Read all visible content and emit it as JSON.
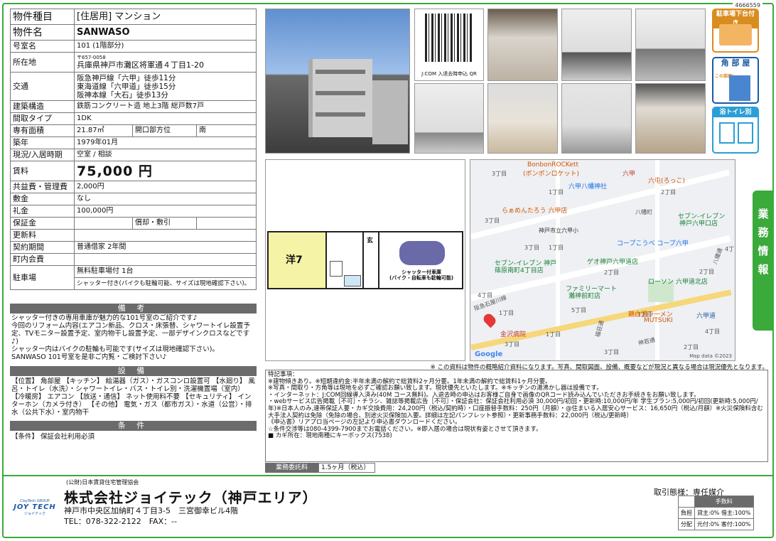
{
  "doc_id": "4666559",
  "table": {
    "type_label": "物件種目",
    "type_value": "[住居用] マンション",
    "name_label": "物件名",
    "name_value": "SANWASO",
    "room_label": "号室名",
    "room_value": "101 (1階部分)",
    "address_label": "所在地",
    "postal": "〒657-0058",
    "address_value": "兵庫県神戸市灘区将軍通４丁目1-20",
    "transport_label": "交通",
    "transport_lines": [
      "阪急神戸線「六甲」徒歩11分",
      "東海道線「六甲道」徒歩15分",
      "阪神本線「大石」徒歩13分"
    ],
    "structure_label": "建築構造",
    "structure_value": "鉄筋コンクリート造 地上3階 総戸数7戸",
    "layout_label": "間取タイプ",
    "layout_value": "1DK",
    "area_label": "専有面積",
    "area_value": "21.87㎡",
    "opening_label": "開口部方位",
    "opening_value": "南",
    "built_label": "築年",
    "built_value": "1979年01月",
    "status_label": "現況/入居時期",
    "status_value": "空室 / 相談",
    "rent_label": "賃料",
    "rent_value": "75,000 円",
    "mgmt_label": "共益費・管理費",
    "mgmt_value": "2,000円",
    "deposit_label": "敷金",
    "deposit_value": "なし",
    "key_label": "礼金",
    "key_value": "100,000円",
    "guarantee_label": "保証金",
    "guarantee_value": "",
    "amort_label": "償却・敷引",
    "amort_value": "",
    "renewal_label": "更新料",
    "renewal_value": "",
    "contract_label": "契約期間",
    "contract_value": "普通借家 2年間",
    "association_label": "町内会費",
    "association_value": "",
    "parking_label": "駐車場",
    "parking_value": "無料駐車場付 1台",
    "parking_note": "シャッター付き(バイクも駐輪可能、サイズは現地確認下さい)。"
  },
  "remarks": {
    "title": "備 考",
    "text": "シャッター付きの専用車庫が魅力的な101号室のご紹介です♪\n今回のリフォーム内容(エアコン新品、クロス・床張替、シャワートイレ設置予定、TVモニター設置予定、室内物干し設置予定、一部デザインクロスなどです♪)\nシャッター内はバイクの駐輪も可能です(サイズは現地確認下さい)。\nSANWASO 101号室を是非ご内覧・ご検討下さい♪"
  },
  "equipment": {
    "title": "設 備",
    "text": "【位置】 角部屋 【キッチン】 給湯器（ガス）・ガスコンロ設置可 【水廻り】 風呂・トイレ（水洗）・シャワートイレ・バス・トイレ別・洗濯機置場（室内） 【冷暖房】 エアコン 【放送・通信】 ネット使用料不要 【セキュリティ】 インターホン（カメラ付き） 【その他】 電気・ガス（都市ガス）・水道（公営）・排水（公共下水）・室内物干"
  },
  "conditions": {
    "title": "条 件",
    "text": "【条件】 保証会社利用必須"
  },
  "qr_label": "J:COM 入退去時申込 QR",
  "badges": {
    "parking": "駐車場下台付き",
    "corner": "角 部 屋",
    "corner_sub": "この部屋!",
    "bath": "浴トイレ別"
  },
  "side_tab": "業務情報",
  "floorplan": {
    "room": "洋7",
    "entrance": "玄",
    "garage": "シャッター付車庫\n(バイク・自転車も駐輪可能)"
  },
  "map": {
    "labels": [
      "3丁目",
      "1丁目",
      "2丁目",
      "3丁目",
      "八幡町",
      "3丁目",
      "1丁目",
      "2丁目",
      "4丁目",
      "5丁目",
      "2丁目",
      "3丁目",
      "4丁目",
      "1丁目",
      "3丁目",
      "1丁目",
      "2丁目",
      "4丁目",
      "3丁目",
      "八幡通",
      "福荘通",
      "神若通",
      "阪急石屋川線",
      "神戸市立六甲小"
    ],
    "poi_orange": [
      "BonbonROCKett",
      "(ボンボンロケット)",
      "六屯(ろっこ)",
      "らぁめんたろう 六甲店",
      "鶏白湯ラーメン",
      "MUTSUKI"
    ],
    "poi_blue": [
      "六甲八幡神社",
      "コープこうべ コープ六甲"
    ],
    "poi_green": [
      "セブン-イレブン",
      "神戸六甲口店",
      "セブン-イレブン 神戸",
      "篠原南町4丁目店",
      "ファミリーマート",
      "灘神前町店",
      "ゲオ神戸六甲道店",
      "ローソン 六甲道北店"
    ],
    "poi_red": [
      "六甲",
      "金沢病院",
      "六甲道"
    ],
    "credit": "Map data ©2023",
    "google": "Google"
  },
  "note": "※ この資料は物件の概略紹介資料になります。写真、間取図面、設備、概要などが現況と異なる場合は現況優先となります。",
  "special": {
    "title": "特記事項：",
    "text": "※建物傾きあり。※短期違約金:半年未満の解約で総賃料2ヶ月分要。1年未満の解約で総賃料1ヶ月分要。\n※写真・間取り・方角等は現地を必ずご確認お願い致します。現状優先といたします。※キッチンの湯沸かし器は設備です。\n・インターネット：J:COM回線導入済み(40M コース無料)。入退去時の申込はお客様ご自身で画像のQRコード読み込んでいただきお手続きをお願い致します。\n・webサービス広告掲載［不可］・チラシ、雑誌等掲載広告［不可］・保証会社：保証会社利用必須 30,000円/初回・更新時:10,000円/年 学生プラン:5,000円/初回(更新時:5,000円/年)※日本人のみ,連帯保証人要・カギ交換費用：24,200円（税込/契約時）・口座振替手数料：250円（月額）・@住まいる入居安心サービス：16,650円（税込/月額）※火災保険料含む 大手法人契約は免除（免除の場合、別途火災保険加入要。詳細は左記パンフレット参照）・更新事務手数料：22,000円（税込/更新時）\n《申込書》リアプロ当ページの左記より申込書ダウンロードください。\n☆条件交渉等は080-4399-7900までお電話ください。※即入居の場合は現状有姿とさせて頂きます。\n■ カギ所在：現地南種にキーボックス(7538)"
  },
  "fee": {
    "label": "業務委託料",
    "value": "1.5ヶ月（税込）"
  },
  "footer": {
    "association": "(公財)日本賃貸住宅管理協会",
    "company": "株式会社ジョイテック（神戸エリア）",
    "address": "神戸市中央区加納町４丁目3-5　三宮御幸ビル4階",
    "tel": "TEL：078-322-2122　FAX：--",
    "logo_top": "ClayTech GROUP",
    "logo_main": "JOY TECH",
    "logo_sub": "ジョイテック",
    "trade": "取引態様：専任媒介",
    "fee_header": "手数料",
    "burden_label": "負担",
    "burden_value": "貸主:0%  借主:100%",
    "dist_label": "分配",
    "dist_value": "元付:0%  客付:100%"
  }
}
